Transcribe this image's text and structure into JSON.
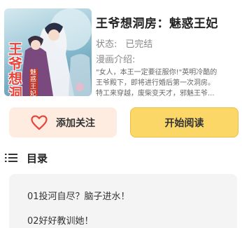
{
  "book": {
    "title": "王爷想洞房：魅惑王妃",
    "status_label": "状态:",
    "status_value": "已完结",
    "intro_label": "漫画介绍:",
    "description_lines": [
      "\"女人，本王一定要征服你!\"英明冷酷的",
      "王爷殿下，即将进行婚后第一次洞房。",
      "特工来穿越，废柴变天才，邪魅王爷..."
    ],
    "cover": {
      "title_text": "王爷想洞房",
      "subtitle_text": "魅惑王妃",
      "colors": {
        "sky": "#a9cfdd",
        "title": "#e8453c",
        "robe": "#7a4a7e"
      }
    }
  },
  "actions": {
    "follow_label": "添加关注",
    "read_label": "开始阅读"
  },
  "toc": {
    "heading": "目录",
    "chapters": [
      {
        "title": "01投河自尽？脑子进水！"
      },
      {
        "title": "02好好教训她！"
      }
    ]
  },
  "colors": {
    "follow_bg": "#fdecdf",
    "heart": "#e8453c",
    "read_bg": "#fbd768",
    "chapter_bg": "#f4f4f4"
  }
}
